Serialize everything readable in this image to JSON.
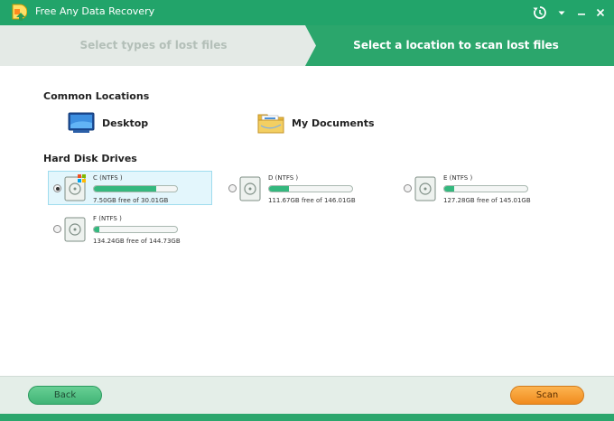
{
  "app": {
    "title": "Free Any Data Recovery",
    "brand_color": "#22a46a",
    "scan_color": "#f5a23a"
  },
  "steps": [
    {
      "label": "Select types of lost files",
      "active": false
    },
    {
      "label": "Select a location to scan lost files",
      "active": true
    }
  ],
  "common_locations": {
    "title": "Common Locations",
    "items": [
      {
        "label": "Desktop",
        "icon": "desktop-icon"
      },
      {
        "label": "My Documents",
        "icon": "documents-folder-icon"
      }
    ]
  },
  "hard_disks": {
    "title": "Hard Disk Drives",
    "drives": [
      {
        "name": "C  (NTFS )",
        "free": "7.50GB free of 30.01GB",
        "used_fraction": 0.75,
        "selected": true,
        "system": true
      },
      {
        "name": "D  (NTFS )",
        "free": "111.67GB free of 146.01GB",
        "used_fraction": 0.24,
        "selected": false,
        "system": false
      },
      {
        "name": "E  (NTFS )",
        "free": "127.28GB free of 145.01GB",
        "used_fraction": 0.12,
        "selected": false,
        "system": false
      },
      {
        "name": "F  (NTFS )",
        "free": "134.24GB free of 144.73GB",
        "used_fraction": 0.07,
        "selected": false,
        "system": false
      }
    ]
  },
  "footer": {
    "back_label": "Back",
    "scan_label": "Scan"
  }
}
